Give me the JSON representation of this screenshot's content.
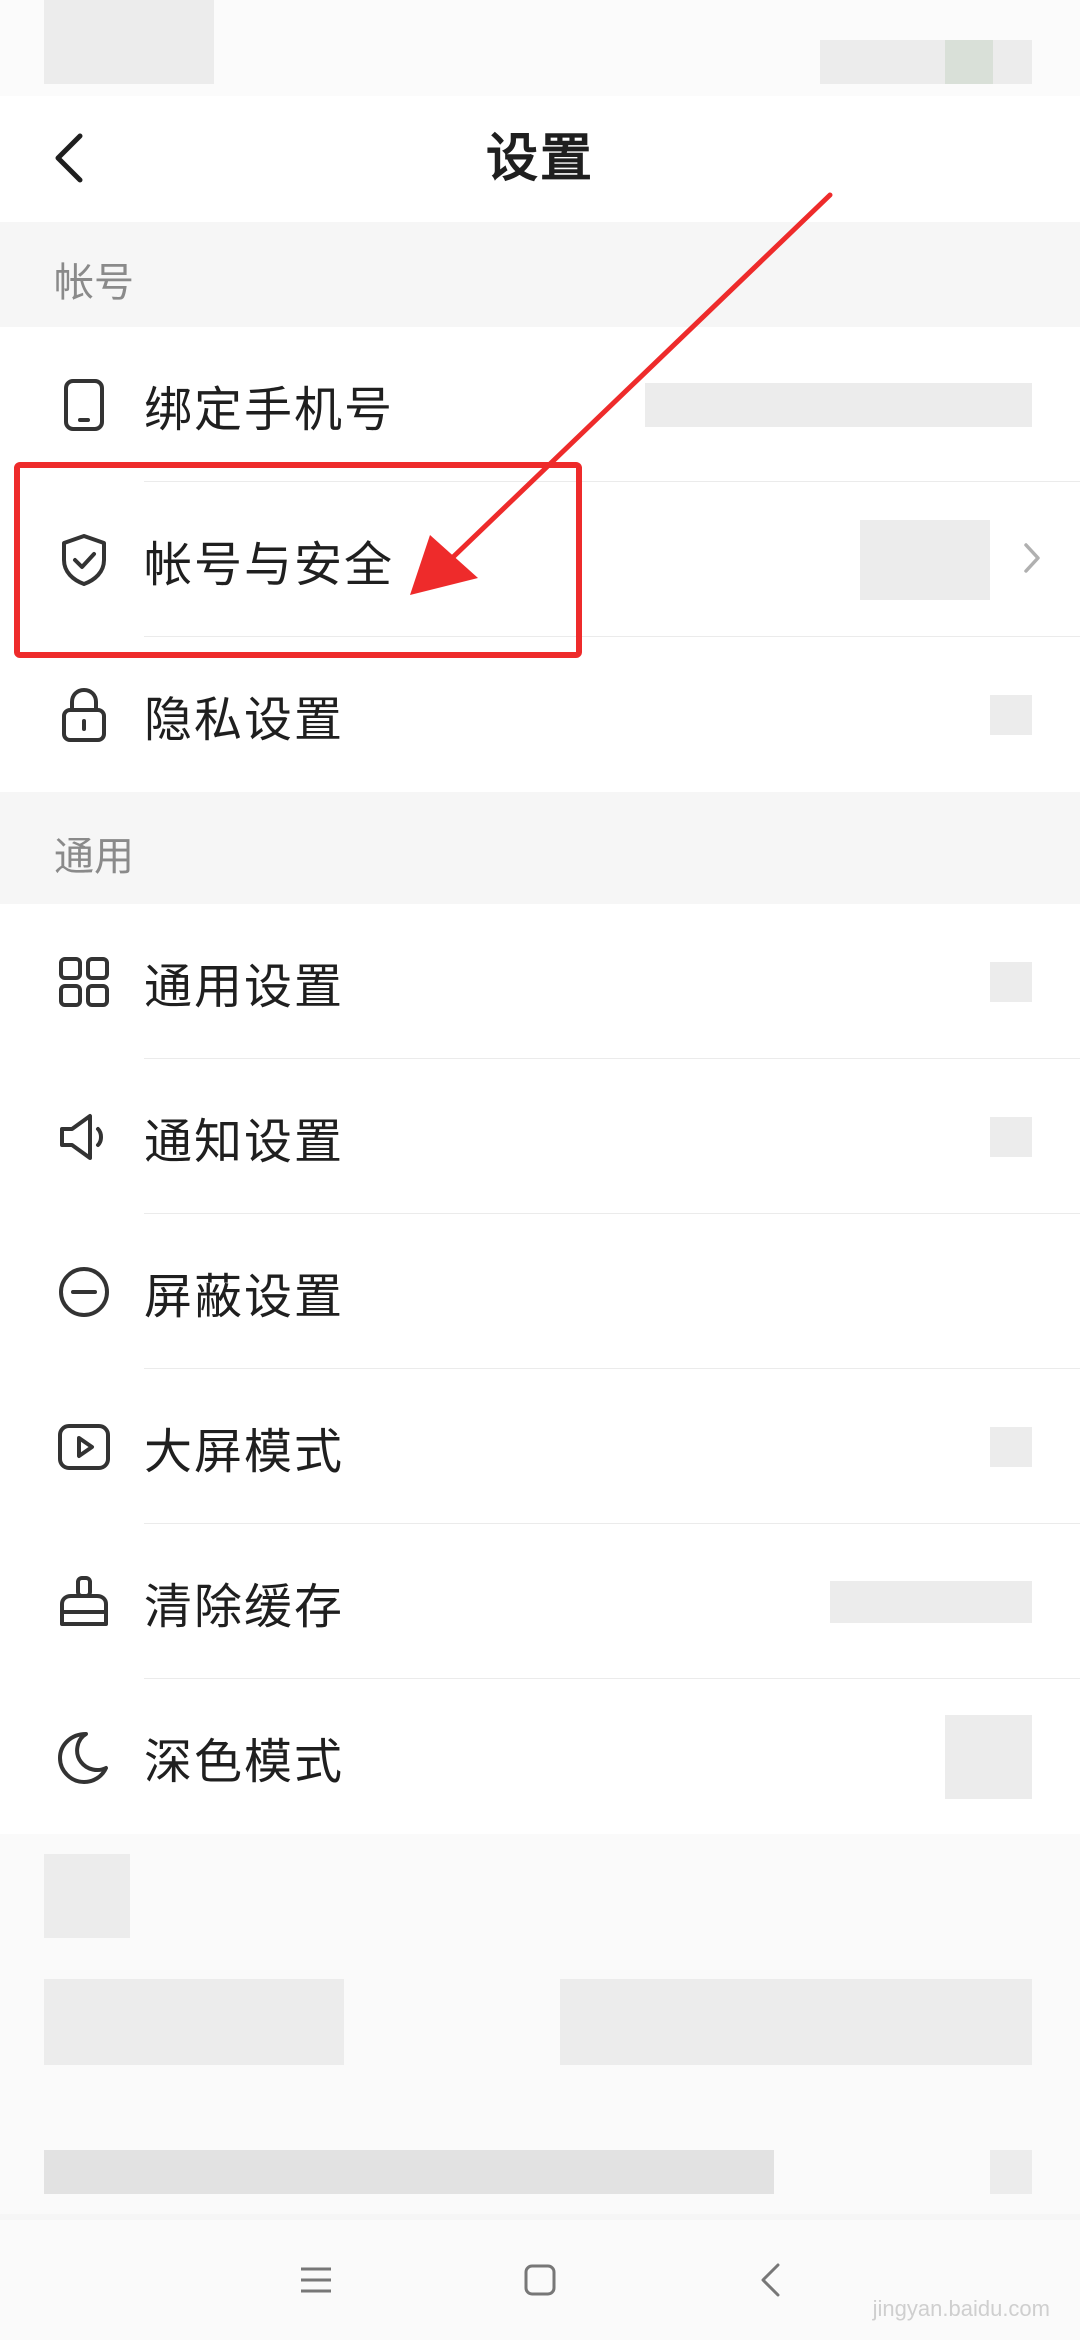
{
  "header": {
    "title": "设置"
  },
  "sections": {
    "account": {
      "title": "帐号",
      "items": [
        {
          "label": "绑定手机号",
          "icon": "phone-icon"
        },
        {
          "label": "帐号与安全",
          "icon": "shield-check-icon"
        },
        {
          "label": "隐私设置",
          "icon": "lock-icon"
        }
      ]
    },
    "general": {
      "title": "通用",
      "items": [
        {
          "label": "通用设置",
          "icon": "grid-icon"
        },
        {
          "label": "通知设置",
          "icon": "speaker-icon"
        },
        {
          "label": "屏蔽设置",
          "icon": "minus-circle-icon"
        },
        {
          "label": "大屏模式",
          "icon": "play-screen-icon"
        },
        {
          "label": "清除缓存",
          "icon": "broom-icon"
        },
        {
          "label": "深色模式",
          "icon": "moon-icon"
        }
      ]
    }
  },
  "annotation": {
    "color": "#ee2b2b"
  },
  "watermark": {
    "text": "jingyan.baidu.com"
  }
}
